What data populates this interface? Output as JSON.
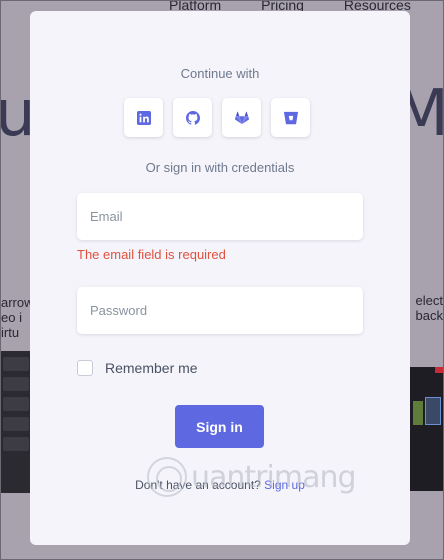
{
  "background": {
    "nav": [
      "Platform",
      "Pricing",
      "Resources"
    ],
    "hero_left": "ua",
    "hero_right": "M",
    "left_text": "arrow\neo i\nirtu",
    "right_text": "elect\nback"
  },
  "modal": {
    "continue_with": "Continue with",
    "providers": [
      {
        "name": "LinkedIn",
        "icon": "linkedin-icon"
      },
      {
        "name": "GitHub",
        "icon": "github-icon"
      },
      {
        "name": "GitLab",
        "icon": "gitlab-icon"
      },
      {
        "name": "Bitbucket",
        "icon": "bitbucket-icon"
      }
    ],
    "or_sign_in": "Or sign in with credentials",
    "email_placeholder": "Email",
    "email_error": "The email field is required",
    "password_placeholder": "Password",
    "remember_me": "Remember me",
    "sign_in": "Sign in",
    "no_account": "Don't have an account?",
    "sign_up": "Sign up"
  },
  "watermark": "uantrimang",
  "colors": {
    "accent": "#5e68e1",
    "error": "#e0523e",
    "modal_bg": "#f4f4fa"
  }
}
